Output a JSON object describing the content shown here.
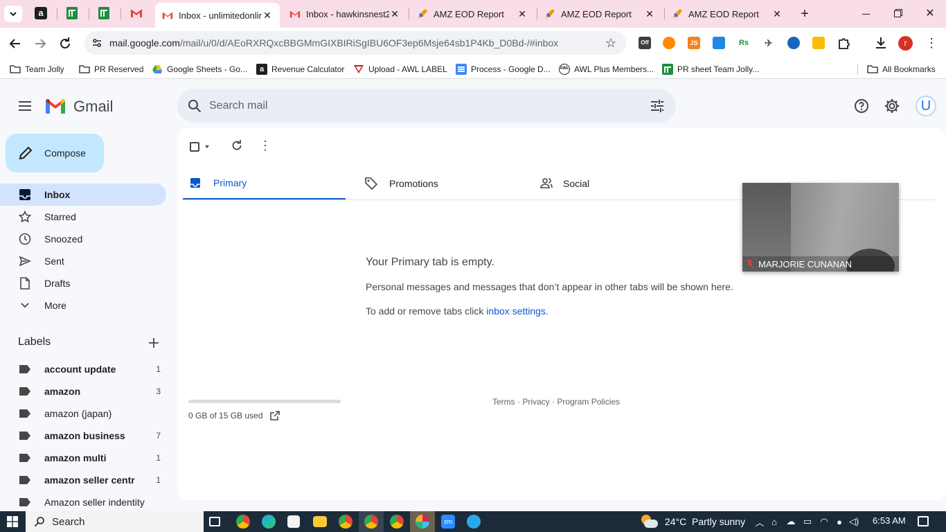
{
  "tabs": [
    {
      "title": "Inbox - unlimitedonlin",
      "active": true
    },
    {
      "title": "Inbox - hawkinsnest2",
      "active": false
    },
    {
      "title": "AMZ EOD Report",
      "active": false
    },
    {
      "title": "AMZ EOD Report",
      "active": false
    },
    {
      "title": "AMZ EOD Report",
      "active": false
    }
  ],
  "omnibox": {
    "domain": "mail.google.com",
    "path": "/mail/u/0/d/AEoRXRQxcBBGMmGIXBIRiSgIBU6OF3ep6Msje64sb1P4Kb_D0Bd-/#inbox"
  },
  "extensions": {
    "off_label": "Off",
    "js_label": "JS",
    "rs_label": "Rs",
    "profile_initial": "r"
  },
  "bookmarks": [
    {
      "label": "Team Jolly"
    },
    {
      "label": "PR Reserved"
    },
    {
      "label": "Google Sheets - Go..."
    },
    {
      "label": "Revenue Calculator"
    },
    {
      "label": "Upload - AWL LABEL"
    },
    {
      "label": "Process - Google D..."
    },
    {
      "label": "AWL Plus Members..."
    },
    {
      "label": "PR sheet Team Jolly..."
    }
  ],
  "all_bookmarks": "All Bookmarks",
  "gmail": {
    "logo_text": "Gmail",
    "search_placeholder": "Search mail",
    "account_initial": "U",
    "compose_label": "Compose",
    "nav": [
      {
        "label": "Inbox",
        "active": true
      },
      {
        "label": "Starred"
      },
      {
        "label": "Snoozed"
      },
      {
        "label": "Sent"
      },
      {
        "label": "Drafts"
      },
      {
        "label": "More"
      }
    ],
    "labels_heading": "Labels",
    "labels": [
      {
        "name": "account update",
        "count": "1",
        "bold": true
      },
      {
        "name": "amazon",
        "count": "3",
        "bold": true
      },
      {
        "name": "amazon (japan)",
        "count": "",
        "bold": false
      },
      {
        "name": "amazon business",
        "count": "7",
        "bold": true
      },
      {
        "name": "amazon multi",
        "count": "1",
        "bold": true
      },
      {
        "name": "amazon seller centr",
        "count": "1",
        "bold": true
      },
      {
        "name": "Amazon seller indentity",
        "count": "",
        "bold": false
      }
    ],
    "inbox_tabs": [
      {
        "label": "Primary",
        "active": true
      },
      {
        "label": "Promotions"
      },
      {
        "label": "Social"
      }
    ],
    "empty": {
      "title": "Your Primary tab is empty.",
      "desc": "Personal messages and messages that don’t appear in other tabs will be shown here.",
      "settings_prefix": "To add or remove tabs click ",
      "settings_link": "inbox settings",
      "settings_suffix": "."
    },
    "storage": {
      "text": "0 GB of 15 GB used",
      "fraction": 0.0
    },
    "footer": {
      "terms": "Terms",
      "dot": " · ",
      "privacy": "Privacy",
      "policies": "Program Policies"
    }
  },
  "video_overlay": {
    "name": "MARJORIE CUNANAN"
  },
  "taskbar": {
    "search": "Search",
    "weather": "24°C  Partly sunny",
    "time": "6:53 AM"
  }
}
